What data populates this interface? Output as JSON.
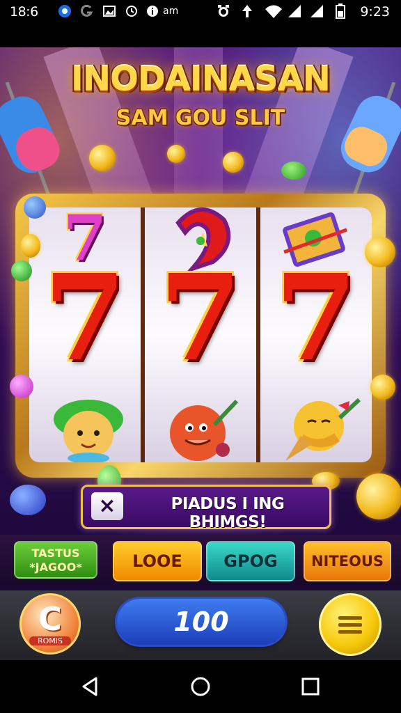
{
  "status_bar": {
    "time": "18:6",
    "carrier": "am",
    "clock_right": "9:23",
    "icons": [
      "app-circle-icon",
      "g-icon",
      "gallery-icon",
      "sync-icon",
      "info-icon",
      "alarm-icon",
      "data-arrows-icon",
      "wifi-icon",
      "signal-icon",
      "signal-icon",
      "battery-icon"
    ]
  },
  "game": {
    "title": "INODAINASAN",
    "subtitle": "SAM GOU SLIT",
    "reels": [
      {
        "top": "7",
        "middle": "7",
        "bottom": "green-haired-character-symbol"
      },
      {
        "top": "horseshoe-symbol",
        "middle": "7",
        "bottom": "orange-fruit-character-symbol"
      },
      {
        "top": "gift-box-symbol",
        "middle": "7",
        "bottom": "ice-cream-character-symbol"
      }
    ],
    "banner": {
      "icon": "×",
      "text": "PIADUS I ING BHIMGS!"
    },
    "buttons": [
      {
        "line1": "TASTUS",
        "line2": "*JAGOO*",
        "color": "#3faa1e"
      },
      {
        "label": "LOOE",
        "color": "#f5a40e"
      },
      {
        "label": "GPOG",
        "color": "#1fb0a8"
      },
      {
        "label": "NITEOUS",
        "color": "#f09618"
      }
    ],
    "bonus_button": {
      "glyph": "C",
      "label": "ROMIS"
    },
    "credit": "100",
    "menu_icon": "hamburger-icon"
  },
  "nav_bar": {
    "icons": [
      "back-icon",
      "home-icon",
      "recents-icon"
    ]
  }
}
